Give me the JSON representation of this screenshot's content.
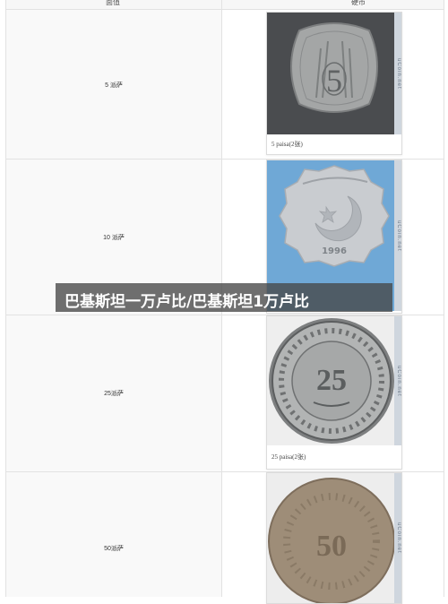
{
  "table": {
    "headers": {
      "denomination": "面值",
      "coin": "硬币"
    },
    "rows": [
      {
        "denomination": "5 派萨",
        "caption": "5 paisa(2张)",
        "coin_text": "5"
      },
      {
        "denomination": "10 派萨",
        "caption": "",
        "coin_text": "1996"
      },
      {
        "denomination": "25派萨",
        "caption": "25 paisa(2张)",
        "coin_text": "25"
      },
      {
        "denomination": "50派萨",
        "caption": "",
        "coin_text": "50"
      }
    ]
  },
  "watermark": "uCoin.net",
  "banner": {
    "text": "巴基斯坦一万卢比/巴基斯坦1万卢比"
  },
  "colors": {
    "border": "#e2e2e2",
    "banner_bg": "#464646",
    "watermark_bg": "#cfd6de"
  }
}
